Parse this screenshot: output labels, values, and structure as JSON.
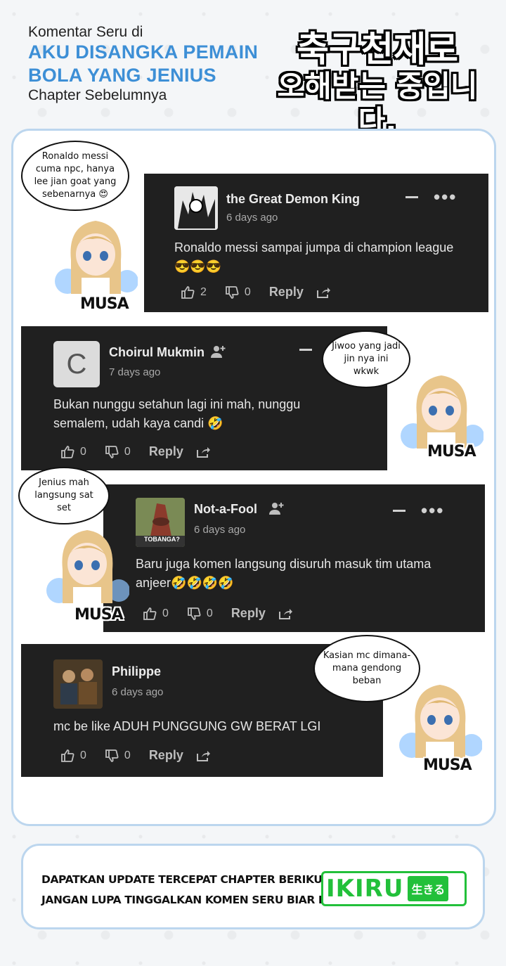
{
  "header": {
    "pre": "Komentar Seru di",
    "title_line1": "AKU DISANGKA PEMAIN",
    "title_line2": "BOLA YANG JENIUS",
    "post": "Chapter Sebelumnya"
  },
  "korean_title": {
    "line1": "축구천재로",
    "line2": "오해받는 중입니다."
  },
  "comments": [
    {
      "name": "the Great Demon King",
      "time": "6 days ago",
      "body": "Ronaldo messi sampai jumpa di champion league 😎😎😎",
      "likes": "2",
      "dislikes": "0",
      "reply": "Reply",
      "bubble": "Ronaldo messi cuma npc, hanya lee jian goat yang sebenarnya 😍",
      "musa": "MUSA"
    },
    {
      "name": "Choirul Mukmin",
      "time": "7 days ago",
      "avatar_letter": "C",
      "body": "Bukan nunggu setahun lagi ini mah, nunggu semalem, udah kaya candi 🤣",
      "likes": "0",
      "dislikes": "0",
      "reply": "Reply",
      "bubble": "Jiwoo yang jadi jin nya ini wkwk",
      "musa": "MUSA"
    },
    {
      "name": "Not-a-Fool",
      "time": "6 days ago",
      "avatar_caption": "TOBANGA?",
      "body": "Baru juga komen langsung disuruh masuk tim utama anjeer🤣🤣🤣🤣",
      "likes": "0",
      "dislikes": "0",
      "reply": "Reply",
      "bubble": "Jenius mah langsung sat set",
      "musa": "MUSA"
    },
    {
      "name": "Philippe",
      "time": "6 days ago",
      "body": "mc be like ADUH PUNGGUNG GW BERAT LGI",
      "likes": "0",
      "dislikes": "0",
      "reply": "Reply",
      "bubble": "Kasian mc dimana-mana gendong beban",
      "musa": "MUSA"
    }
  ],
  "footer": {
    "line1": "DAPATKAN UPDATE TERCEPAT CHAPTER BERIKUTNYA DI",
    "line2": "JANGAN LUPA TINGGALKAN KOMEN SERU BIAR DI NOTIS",
    "brand": "IKIRU",
    "brand_jp": "生きる"
  },
  "colors": {
    "accent": "#3d8fd6",
    "comment_bg": "#202020",
    "brand_green": "#22c03a",
    "card_border": "#bcd6ee"
  }
}
